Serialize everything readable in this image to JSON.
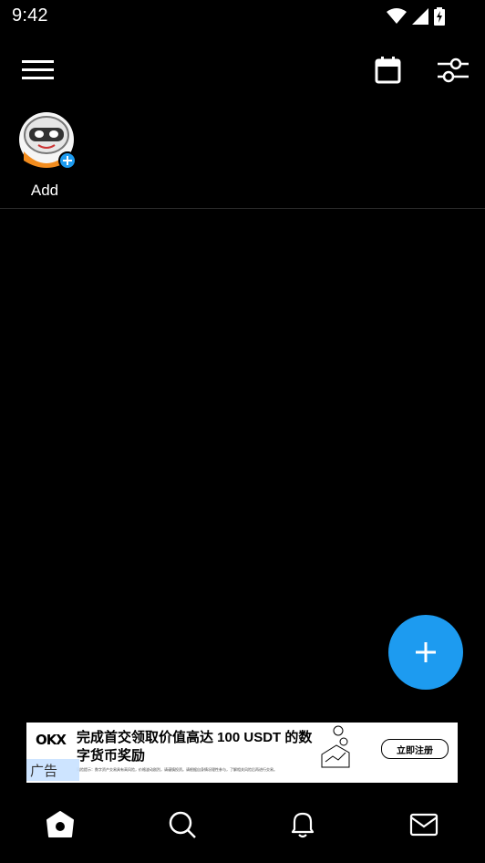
{
  "status_bar": {
    "time": "9:42",
    "icons": [
      "wifi-icon",
      "signal-icon",
      "battery-charging-icon"
    ]
  },
  "app_bar": {
    "icons": [
      "menu-icon",
      "calendar-icon",
      "filter-sliders-icon"
    ]
  },
  "stories": {
    "add_label": "Add"
  },
  "fab": {
    "icon": "plus-icon",
    "color": "#1d9bf0"
  },
  "ad": {
    "logo_text": "OKX",
    "headline": "完成首交领取价值高达 100 USDT 的数字货币奖励",
    "cta": "立即注册",
    "badge": "广告",
    "fine_print": "风险提示：数字资产交易具有高风险，价格波动剧烈，请谨慎投资。请根据自身情况理性参与，了解相关风险后再进行交易。"
  },
  "bottom_nav": {
    "items": [
      "home-icon",
      "search-icon",
      "notifications-icon",
      "messages-icon"
    ]
  },
  "colors": {
    "background": "#000000",
    "accent": "#1d9bf0",
    "text": "#ffffff"
  }
}
